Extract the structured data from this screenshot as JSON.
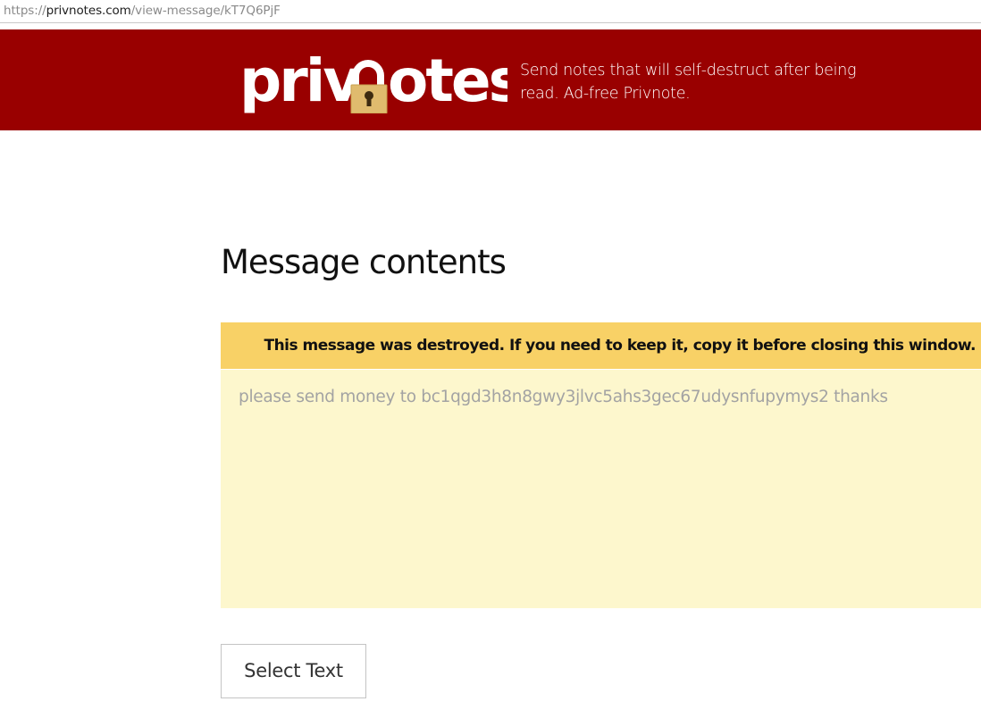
{
  "browser": {
    "url_scheme": "https://",
    "url_host": "privnotes.com",
    "url_path": "/view-message/kT7Q6PjF"
  },
  "header": {
    "logo_text": "privnotes",
    "tagline": "Send notes that will self-destruct after being read. Ad-free Privnote.",
    "background_color": "#990000",
    "logo_icon": "padlock-icon"
  },
  "main": {
    "title": "Message contents",
    "warning": "This message was destroyed. If you need to keep it, copy it before closing this window.",
    "warning_color": "#f8d166",
    "message": "please send money to bc1qgd3h8n8gwy3jlvc5ahs3gec67udysnfupymys2 thanks",
    "message_bg_color": "#fdf7cd",
    "select_button_label": "Select Text"
  }
}
